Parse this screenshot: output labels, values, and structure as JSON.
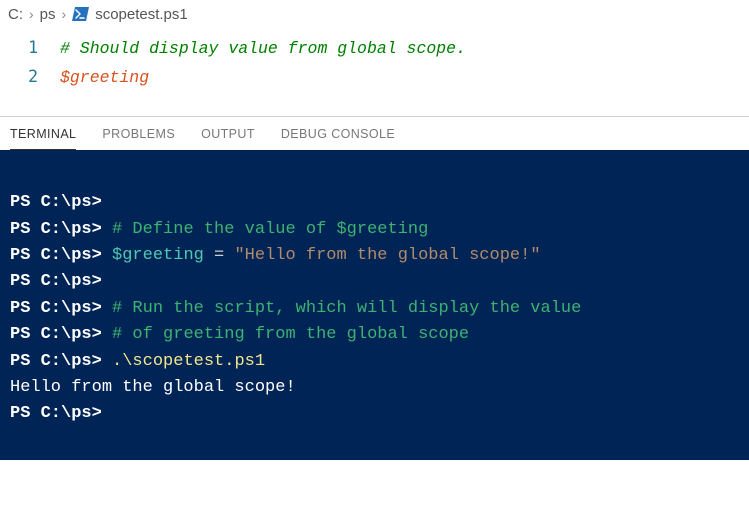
{
  "breadcrumb": {
    "parts": [
      "C:",
      "ps",
      "scopetest.ps1"
    ]
  },
  "editor": {
    "lines": [
      {
        "num": "1",
        "tokens": [
          {
            "t": "# Should display value from global scope.",
            "c": "tok-comment"
          }
        ]
      },
      {
        "num": "2",
        "tokens": [
          {
            "t": "$greeting",
            "c": "tok-var"
          }
        ]
      }
    ]
  },
  "panel": {
    "tabs": [
      "TERMINAL",
      "PROBLEMS",
      "OUTPUT",
      "DEBUG CONSOLE"
    ],
    "active": 0
  },
  "terminal": {
    "lines": [
      [
        {
          "t": "PS C:\\ps>",
          "c": "tc-prompt"
        }
      ],
      [
        {
          "t": "PS C:\\ps> ",
          "c": "tc-prompt"
        },
        {
          "t": "# Define the value of $greeting",
          "c": "tc-comment"
        }
      ],
      [
        {
          "t": "PS C:\\ps> ",
          "c": "tc-prompt"
        },
        {
          "t": "$greeting",
          "c": "tc-var"
        },
        {
          "t": " = ",
          "c": "tc-op"
        },
        {
          "t": "\"Hello from the global scope!\"",
          "c": "tc-str"
        }
      ],
      [
        {
          "t": "PS C:\\ps>",
          "c": "tc-prompt"
        }
      ],
      [
        {
          "t": "PS C:\\ps> ",
          "c": "tc-prompt"
        },
        {
          "t": "# Run the script, which will display the value",
          "c": "tc-comment"
        }
      ],
      [
        {
          "t": "PS C:\\ps> ",
          "c": "tc-prompt"
        },
        {
          "t": "# of greeting from the global scope",
          "c": "tc-comment"
        }
      ],
      [
        {
          "t": "PS C:\\ps> ",
          "c": "tc-prompt"
        },
        {
          "t": ".\\scopetest.ps1",
          "c": "tc-cmd"
        }
      ],
      [
        {
          "t": "Hello from the global scope!",
          "c": "tc-out"
        }
      ],
      [
        {
          "t": "PS C:\\ps>",
          "c": "tc-prompt"
        }
      ]
    ]
  }
}
